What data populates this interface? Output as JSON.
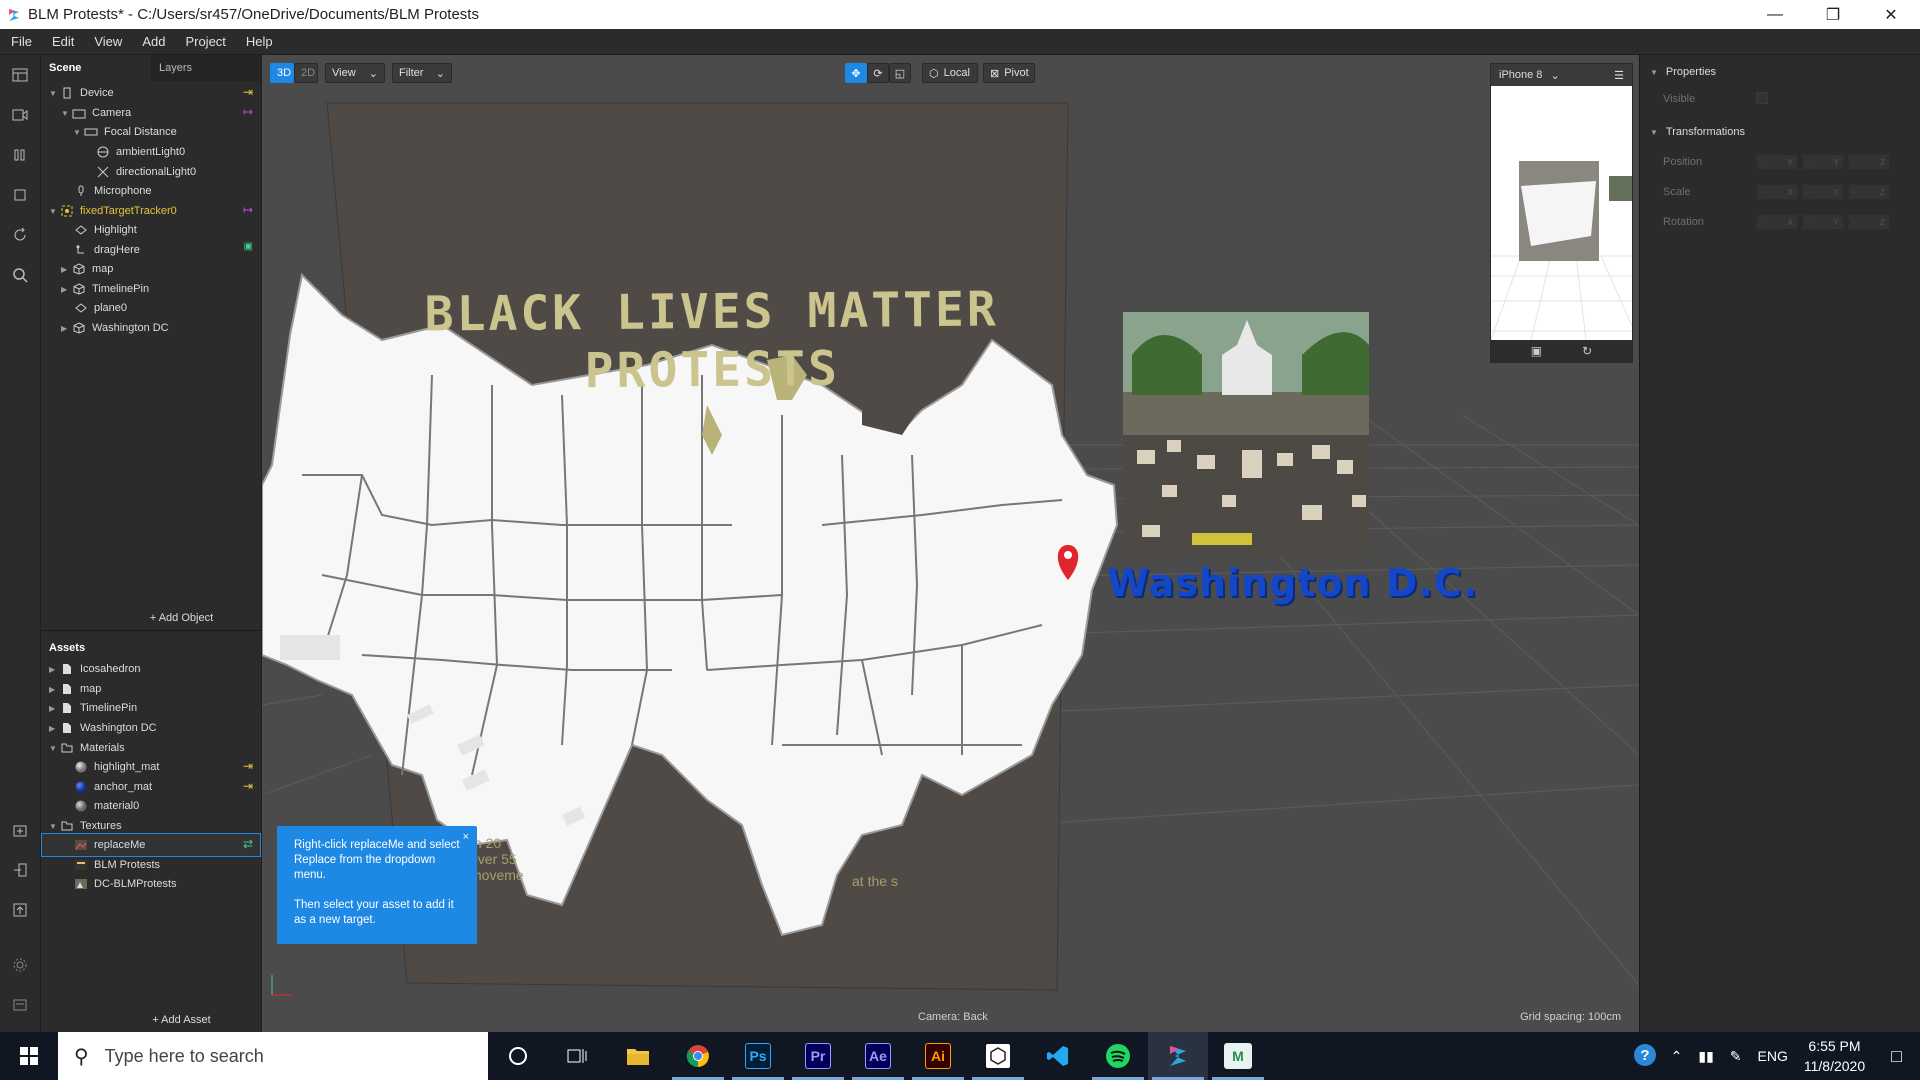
{
  "window": {
    "title": "BLM Protests* - C:/Users/sr457/OneDrive/Documents/BLM Protests",
    "controls": [
      "minimize",
      "maximize",
      "close"
    ]
  },
  "menu": [
    "File",
    "Edit",
    "View",
    "Add",
    "Project",
    "Help"
  ],
  "scene": {
    "tabs": [
      "Scene",
      "Layers"
    ],
    "items": [
      {
        "label": "Device",
        "icon": "device-icon"
      },
      {
        "label": "Camera",
        "icon": "camera-icon"
      },
      {
        "label": "Focal Distance",
        "icon": "focal-distance-icon"
      },
      {
        "label": "ambientLight0",
        "icon": "light-icon"
      },
      {
        "label": "directionalLight0",
        "icon": "directional-light-icon"
      },
      {
        "label": "Microphone",
        "icon": "microphone-icon"
      },
      {
        "label": "fixedTargetTracker0",
        "icon": "target-tracker-icon"
      },
      {
        "label": "Highlight",
        "icon": "plane-icon"
      },
      {
        "label": "dragHere",
        "icon": "drag-icon"
      },
      {
        "label": "map",
        "icon": "cube-icon"
      },
      {
        "label": "TimelinePin",
        "icon": "cube-icon"
      },
      {
        "label": "plane0",
        "icon": "plane-icon"
      },
      {
        "label": "Washington DC",
        "icon": "cube-icon"
      }
    ],
    "add_object": "+ Add Object"
  },
  "assets": {
    "title": "Assets",
    "items": [
      {
        "label": "Icosahedron",
        "icon": "file-icon"
      },
      {
        "label": "map",
        "icon": "file-icon"
      },
      {
        "label": "TimelinePin",
        "icon": "file-icon"
      },
      {
        "label": "Washington DC",
        "icon": "file-icon"
      },
      {
        "label": "Materials",
        "icon": "folder-icon"
      },
      {
        "label": "highlight_mat",
        "icon": "material-sphere-icon"
      },
      {
        "label": "anchor_mat",
        "icon": "material-sphere-icon"
      },
      {
        "label": "material0",
        "icon": "material-sphere-icon"
      },
      {
        "label": "Textures",
        "icon": "folder-icon"
      },
      {
        "label": "replaceMe",
        "icon": "texture-icon"
      },
      {
        "label": "BLM Protests",
        "icon": "texture-icon"
      },
      {
        "label": "DC-BLMProtests",
        "icon": "texture-icon"
      }
    ],
    "add_asset": "+ Add Asset"
  },
  "viewport": {
    "toolbar": {
      "mode_3d": "3D",
      "mode_2d": "2D",
      "view": "View",
      "filter": "Filter",
      "local": "Local",
      "pivot": "Pivot"
    },
    "poster_title_line1": "BLACK LIVES MATTER",
    "poster_title_line2": "PROTESTS",
    "map_partial_text_1": "In 20",
    "map_partial_text_2": "over 55",
    "map_partial_text_3": "moveme",
    "map_partial_text_4": "at the s",
    "location_label": "Washington D.C.",
    "camera_label": "Camera: Back",
    "grid_label": "Grid spacing: 100cm"
  },
  "device_preview": {
    "device": "iPhone 8"
  },
  "tooltip": {
    "line1": "Right-click replaceMe and select Replace from the dropdown menu.",
    "line2": "Then select your asset to add it as a new target.",
    "close": "×"
  },
  "properties": {
    "title": "Properties",
    "visible": "Visible",
    "transformations": "Transformations",
    "position": "Position",
    "scale": "Scale",
    "rotation": "Rotation",
    "axes": [
      "X",
      "Y",
      "Z"
    ],
    "placeholder": "-"
  },
  "taskbar": {
    "search_placeholder": "Type here to search",
    "apps": [
      {
        "name": "cortana",
        "label": ""
      },
      {
        "name": "task-view",
        "label": ""
      },
      {
        "name": "file-explorer",
        "label": ""
      },
      {
        "name": "chrome",
        "label": ""
      },
      {
        "name": "photoshop",
        "label": "Ps"
      },
      {
        "name": "premiere",
        "label": "Pr"
      },
      {
        "name": "after-effects",
        "label": "Ae"
      },
      {
        "name": "illustrator",
        "label": "Ai"
      },
      {
        "name": "unity",
        "label": ""
      },
      {
        "name": "vscode",
        "label": ""
      },
      {
        "name": "spotify",
        "label": ""
      },
      {
        "name": "spark-ar",
        "label": ""
      },
      {
        "name": "m-app",
        "label": "M"
      }
    ],
    "language": "ENG",
    "time": "6:55 PM",
    "date": "11/8/2020"
  },
  "colors": {
    "accent": "#1e88e5",
    "tracker_yellow": "#e4c43a",
    "poster_bg": "#4f4a46",
    "poster_text": "#cbc48f",
    "location_text": "#1447c8",
    "pin_red": "#e0262d"
  }
}
